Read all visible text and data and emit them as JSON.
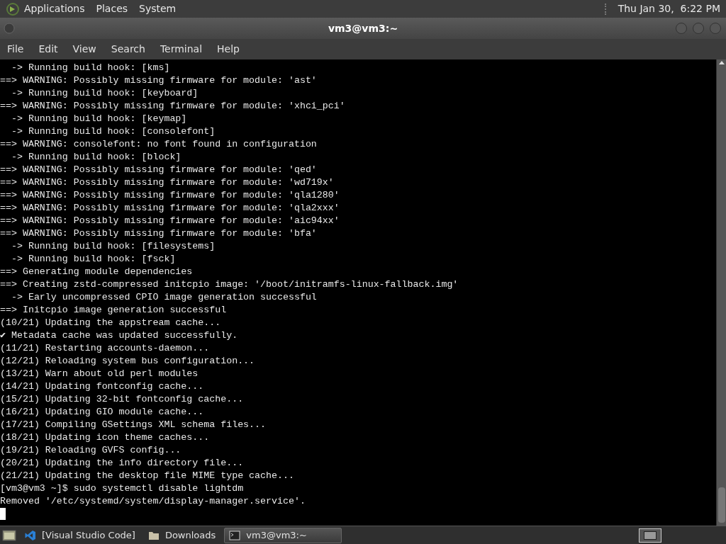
{
  "top_panel": {
    "menus": [
      "Applications",
      "Places",
      "System"
    ],
    "clock": "Thu Jan 30,  6:22 PM"
  },
  "window": {
    "title": "vm3@vm3:~"
  },
  "menu_bar": [
    "File",
    "Edit",
    "View",
    "Search",
    "Terminal",
    "Help"
  ],
  "terminal": {
    "lines": [
      "  -> Running build hook: [kms]",
      "==> WARNING: Possibly missing firmware for module: 'ast'",
      "  -> Running build hook: [keyboard]",
      "==> WARNING: Possibly missing firmware for module: 'xhci_pci'",
      "  -> Running build hook: [keymap]",
      "  -> Running build hook: [consolefont]",
      "==> WARNING: consolefont: no font found in configuration",
      "  -> Running build hook: [block]",
      "==> WARNING: Possibly missing firmware for module: 'qed'",
      "==> WARNING: Possibly missing firmware for module: 'wd719x'",
      "==> WARNING: Possibly missing firmware for module: 'qla1280'",
      "==> WARNING: Possibly missing firmware for module: 'qla2xxx'",
      "==> WARNING: Possibly missing firmware for module: 'aic94xx'",
      "==> WARNING: Possibly missing firmware for module: 'bfa'",
      "  -> Running build hook: [filesystems]",
      "  -> Running build hook: [fsck]",
      "==> Generating module dependencies",
      "==> Creating zstd-compressed initcpio image: '/boot/initramfs-linux-fallback.img'",
      "  -> Early uncompressed CPIO image generation successful",
      "==> Initcpio image generation successful",
      "(10/21) Updating the appstream cache...",
      "✔ Metadata cache was updated successfully.",
      "(11/21) Restarting accounts-daemon...",
      "(12/21) Reloading system bus configuration...",
      "(13/21) Warn about old perl modules",
      "(14/21) Updating fontconfig cache...",
      "(15/21) Updating 32-bit fontconfig cache...",
      "(16/21) Updating GIO module cache...",
      "(17/21) Compiling GSettings XML schema files...",
      "(18/21) Updating icon theme caches...",
      "(19/21) Reloading GVFS config...",
      "(20/21) Updating the info directory file...",
      "(21/21) Updating the desktop file MIME type cache...",
      "[vm3@vm3 ~]$ sudo systemctl disable lightdm",
      "Removed '/etc/systemd/system/display-manager.service'."
    ]
  },
  "taskbar": {
    "items": [
      {
        "kind": "code",
        "label": "[Visual Studio Code]",
        "selected": false
      },
      {
        "kind": "folder",
        "label": "Downloads",
        "selected": false
      },
      {
        "kind": "terminal",
        "label": "vm3@vm3:~",
        "selected": true
      }
    ]
  }
}
